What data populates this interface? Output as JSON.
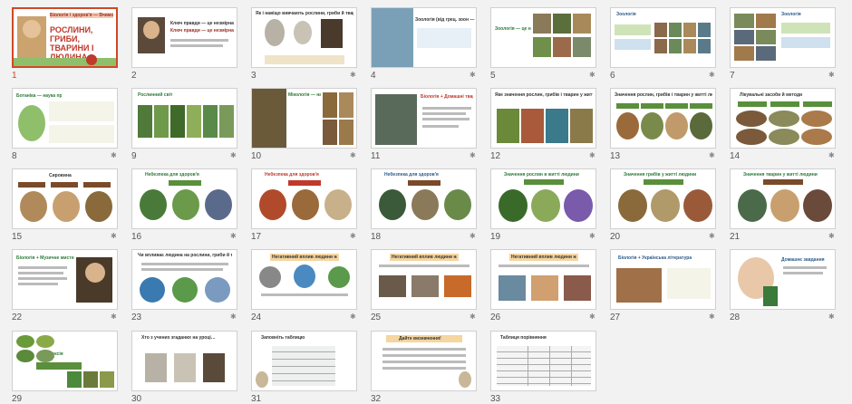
{
  "app": {
    "view": "slide-sorter"
  },
  "slides": [
    {
      "n": "1",
      "title": "РОСЛИНИ, ГРИБИ, ТВАРИНИ І ЛЮДИНА",
      "selected": true,
      "anim": false
    },
    {
      "n": "2",
      "title": "Ключ правди — це незмірна дорога…",
      "anim": false
    },
    {
      "n": "3",
      "title": "Як і навіщо вивчають рослини, гриби й тварин?",
      "anim": true
    },
    {
      "n": "4",
      "title": "Зоологія (від грец. зоон — тварина)…",
      "anim": true
    },
    {
      "n": "5",
      "title": "Зоологія — це наука про тварин",
      "anim": true
    },
    {
      "n": "6",
      "title": "Зоологія",
      "anim": true
    },
    {
      "n": "7",
      "title": "Зоологія",
      "anim": true
    },
    {
      "n": "8",
      "title": "Ботаніка — наука про рослини",
      "anim": true
    },
    {
      "n": "9",
      "title": "Рослинний світ",
      "anim": true
    },
    {
      "n": "10",
      "title": "Мікологія (від грец. мікос — гриби)",
      "anim": true
    },
    {
      "n": "11",
      "title": "Біологія + Домашні тварини",
      "anim": true
    },
    {
      "n": "12",
      "title": "Яке значення рослин, грибів і тварин у житті людини?",
      "anim": true
    },
    {
      "n": "13",
      "title": "Значення рослин, грибів і тварин у житті людини",
      "anim": true
    },
    {
      "n": "14",
      "title": "Лікувальні засоби й методи",
      "anim": true
    },
    {
      "n": "15",
      "title": "Сировина",
      "anim": true
    },
    {
      "n": "16",
      "title": "Небезпека для здоров'я",
      "anim": true
    },
    {
      "n": "17",
      "title": "Небезпека для здоров'я",
      "anim": true
    },
    {
      "n": "18",
      "title": "Небезпека для здоров'я",
      "anim": true
    },
    {
      "n": "19",
      "title": "Значення рослин в житті людини",
      "anim": true
    },
    {
      "n": "20",
      "title": "Значення грибів у житті людини",
      "anim": true
    },
    {
      "n": "21",
      "title": "Значення тварин у житті людини",
      "anim": true
    },
    {
      "n": "22",
      "title": "Біологія + Музичне мистецтво",
      "anim": true
    },
    {
      "n": "23",
      "title": "Чи впливає людина на рослини, гриби й тварин?",
      "anim": true
    },
    {
      "n": "24",
      "title": "Негативний вплив людини на їх довкілля",
      "anim": true
    },
    {
      "n": "25",
      "title": "Негативний вплив людини на їх довкілля",
      "anim": true
    },
    {
      "n": "26",
      "title": "Негативний вплив людини на їх довкілля",
      "anim": true
    },
    {
      "n": "27",
      "title": "Біологія + Українська література",
      "anim": true
    },
    {
      "n": "28",
      "title": "Домашнє завдання",
      "anim": true
    },
    {
      "n": "29",
      "title": "Рефлексія",
      "anim": false
    },
    {
      "n": "30",
      "title": "Хто з учених згаданих на уроці…",
      "anim": false
    },
    {
      "n": "31",
      "title": "Заповніть таблицю",
      "anim": false
    },
    {
      "n": "32",
      "title": "Дайте визначення!",
      "anim": false
    },
    {
      "n": "33",
      "title": "Таблиця порівняння",
      "anim": false
    }
  ],
  "slide1": {
    "badge": "Біологія і здоров'я — Вчимося Cool!",
    "title": "РОСЛИНИ, ГРИБИ, ТВАРИНИ І ЛЮДИНА"
  },
  "labels": {
    "s2": "Ключ правди — це незмірна дорога людського пізнання",
    "s3": "Як і навіщо вивчають рослини, гриби й тварин?",
    "s4": "Зоологія (від грец. зоон — тварина) — наука про тварин",
    "s5": "Зоологія — це наука про тварин",
    "s6": "Зоологія",
    "s7": "Зоологія",
    "s8": "Ботаніка — наука про рослини",
    "s9": "Рослинний світ",
    "s10": "Мікологія — наука про гриби",
    "s11": "Біологія + Домашні тварини",
    "s12": "Яке значення рослин, грибів і тварин у житті людини?",
    "s13": "Значення рослин, грибів і тварин у житті людини",
    "s14": "Лікувальні засоби й методи",
    "s15": "Сировина",
    "s16": "Небезпека для здоров'я",
    "s17": "Небезпека для здоров'я",
    "s18": "Небезпека для здоров'я",
    "s19": "Значення рослин в житті людини",
    "s20": "Значення грибів у житті людини",
    "s21": "Значення тварин у житті людини",
    "s22": "Біологія + Музичне мистецтво",
    "s23": "Чи впливає людина на рослини, гриби й тварин?",
    "s24": "Негативний вплив людини на їх довкілля",
    "s25": "Негативний вплив людини на їх довкілля",
    "s26": "Негативний вплив людини на їх довкілля",
    "s27": "Біологія + Українська література",
    "s28": "Домашнє завдання",
    "s29": "Рефлексія",
    "s30": "Хто з учених згаданих на уроці…",
    "s31": "Заповніть таблицю",
    "s32": "Дайте визначення!",
    "s33": "Таблиця порівняння"
  },
  "colors": {
    "accent": "#d24726",
    "green": "#5a8f3c",
    "brown": "#7a4a2a",
    "titleRed": "#c0392b",
    "pill": "#f5d5a0"
  },
  "icons": {
    "animation": "star-icon"
  }
}
